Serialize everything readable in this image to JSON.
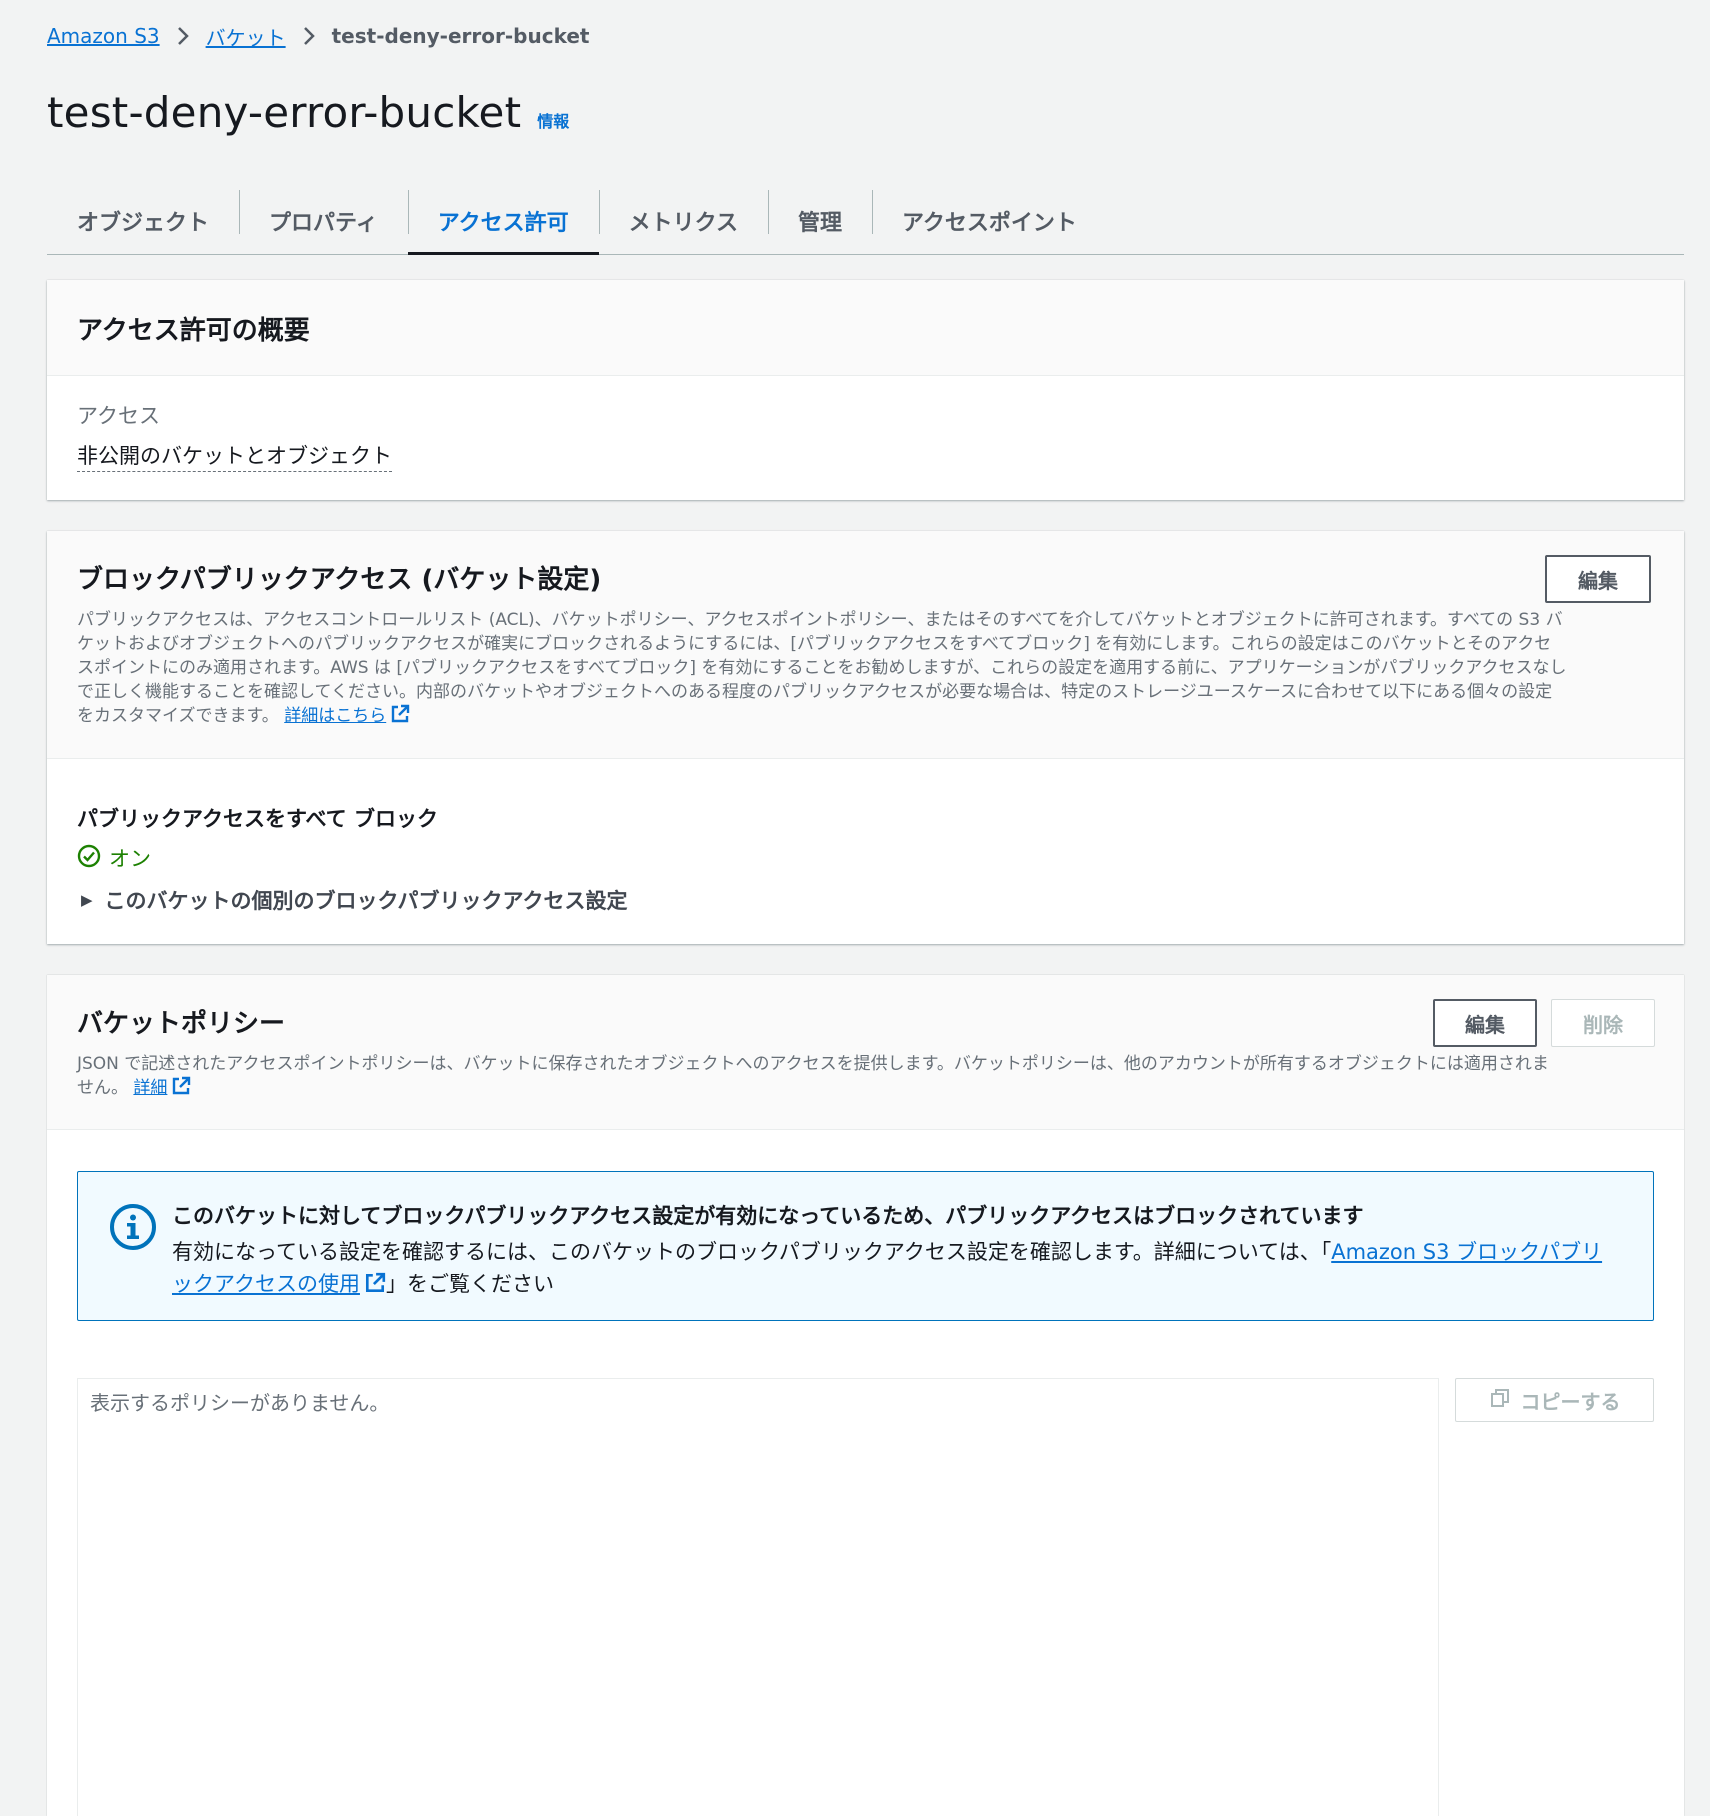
{
  "breadcrumb": {
    "root": "Amazon S3",
    "buckets": "バケット",
    "current": "test-deny-error-bucket"
  },
  "header": {
    "title": "test-deny-error-bucket",
    "info": "情報"
  },
  "tabs": [
    {
      "label": "オブジェクト"
    },
    {
      "label": "プロパティ"
    },
    {
      "label": "アクセス許可"
    },
    {
      "label": "メトリクス"
    },
    {
      "label": "管理"
    },
    {
      "label": "アクセスポイント"
    }
  ],
  "active_tab": "アクセス許可",
  "overview": {
    "title": "アクセス許可の概要",
    "access_label": "アクセス",
    "access_value": "非公開のバケットとオブジェクト"
  },
  "block_public_access": {
    "title": "ブロックパブリックアクセス (バケット設定)",
    "edit": "編集",
    "description_line1": "パブリックアクセスは、アクセスコントロールリスト (ACL)、バケットポリシー、アクセスポイントポリシー、またはそのすべてを介してバケットとオブジェクトに許可されます。すべての S3 バ",
    "description_line2": "ケットおよびオブジェクトへのパブリックアクセスが確実にブロックされるようにするには、[パブリックアクセスをすべてブロック] を有効にします。これらの設定はこのバケットとそのアクセ",
    "description_line3": "スポイントにのみ適用されます。AWS は [パブリックアクセスをすべてブロック] を有効にすることをお勧めしますが、これらの設定を適用する前に、アプリケーションがパブリックアクセスなし",
    "description_line4": "で正しく機能することを確認してください。内部のバケットやオブジェクトへのある程度のパブリックアクセスが必要な場合は、特定のストレージユースケースに合わせて以下にある個々の設定",
    "description_line5": "をカスタマイズできます。",
    "learn_more": "詳細はこちら",
    "block_all_label": "パブリックアクセスをすべて ブロック",
    "status": "オン",
    "status_color": "#1d8102",
    "individual_settings": "このバケットの個別のブロックパブリックアクセス設定"
  },
  "bucket_policy": {
    "title": "バケットポリシー",
    "edit": "編集",
    "delete": "削除",
    "description_line1": "JSON で記述されたアクセスポイントポリシーは、バケットに保存されたオブジェクトへのアクセスを提供します。バケットポリシーは、他のアカウントが所有するオブジェクトには適用されま",
    "description_line2": "せん。",
    "learn_more": "詳細",
    "alert": {
      "title": "このバケットに対してブロックパブリックアクセス設定が有効になっているため、パブリックアクセスはブロックされています",
      "text_before": "有効になっている設定を確認するには、このバケットのブロックパブリックアクセス設定を確認します。詳細については、「",
      "link_part1": "Amazon S3 ブロックパブリ",
      "link_part2": "ックアクセスの使用",
      "text_after": "」をご覧ください"
    },
    "placeholder": "表示するポリシーがありません。",
    "copy": "コピーする"
  },
  "colors": {
    "link": "#0972d3",
    "background": "#f2f3f3",
    "info_bg": "#f1faff",
    "info_border": "#0073bb"
  }
}
